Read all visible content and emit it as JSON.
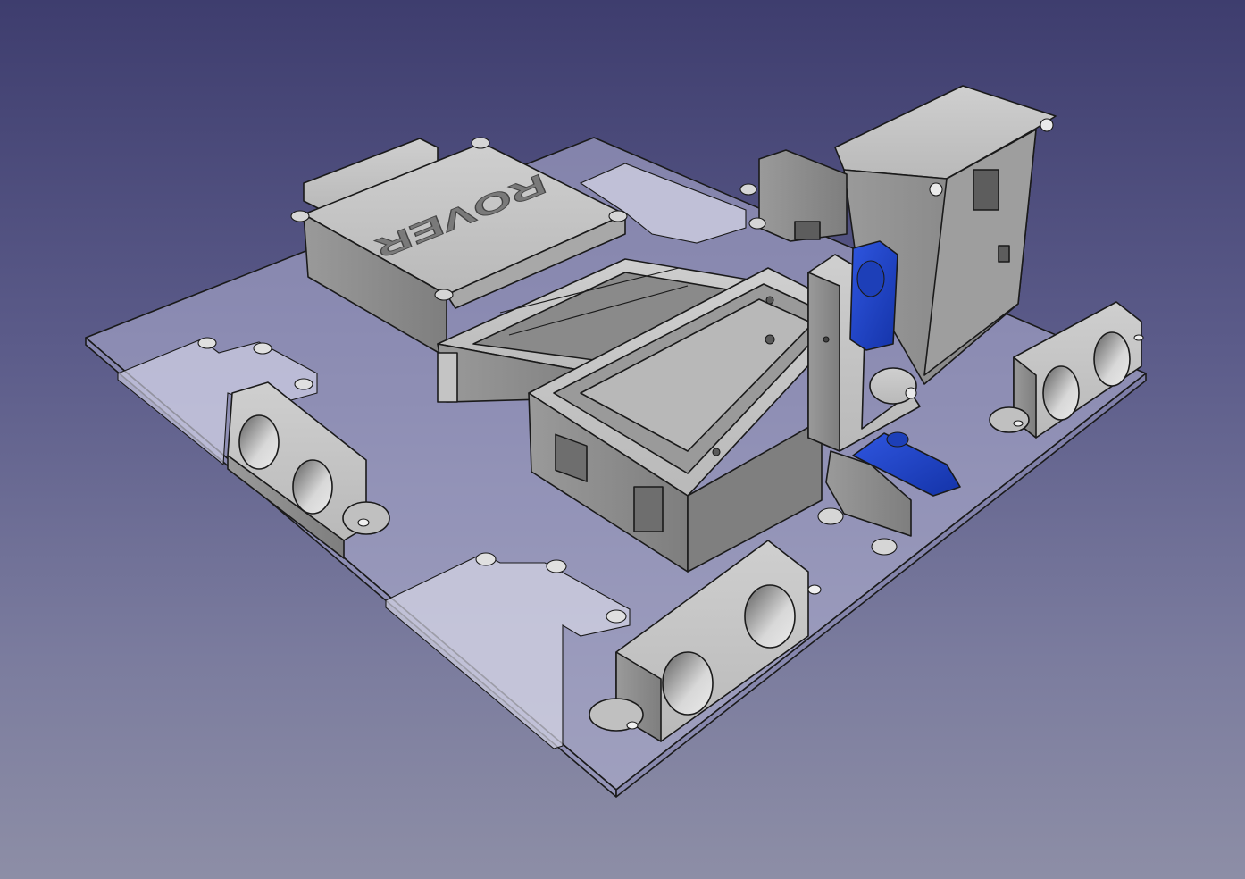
{
  "viewport": {
    "background_top": "#3e3d6e",
    "background_bottom": "#8d8ea6"
  },
  "model": {
    "embossed_text": "ROVER",
    "part_color": "#c8c8c8",
    "part_shadow_color": "#8c8c8c",
    "base_plate_color": "#b8b8d8",
    "servo_color": "#1f43c8"
  }
}
